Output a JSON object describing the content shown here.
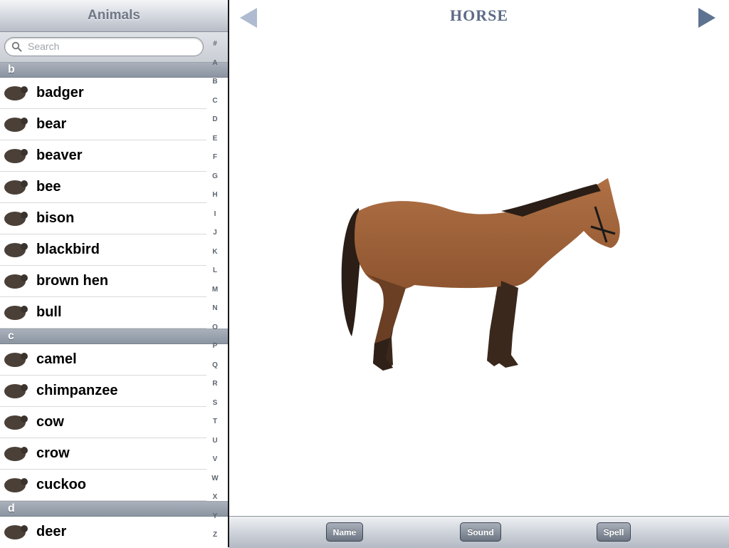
{
  "sidebar": {
    "title": "Animals",
    "search": {
      "placeholder": "Search",
      "value": ""
    },
    "index": [
      "#",
      "A",
      "B",
      "C",
      "D",
      "E",
      "F",
      "G",
      "H",
      "I",
      "J",
      "K",
      "L",
      "M",
      "N",
      "O",
      "P",
      "Q",
      "R",
      "S",
      "T",
      "U",
      "V",
      "W",
      "X",
      "Y",
      "Z"
    ],
    "sections": [
      {
        "letter": "b",
        "items": [
          {
            "label": "badger",
            "icon": "badger-icon"
          },
          {
            "label": "bear",
            "icon": "bear-icon"
          },
          {
            "label": "beaver",
            "icon": "beaver-icon"
          },
          {
            "label": "bee",
            "icon": "bee-icon"
          },
          {
            "label": "bison",
            "icon": "bison-icon"
          },
          {
            "label": "blackbird",
            "icon": "blackbird-icon"
          },
          {
            "label": "brown hen",
            "icon": "hen-icon"
          },
          {
            "label": "bull",
            "icon": "bull-icon"
          }
        ]
      },
      {
        "letter": "c",
        "items": [
          {
            "label": "camel",
            "icon": "camel-icon"
          },
          {
            "label": "chimpanzee",
            "icon": "chimpanzee-icon"
          },
          {
            "label": "cow",
            "icon": "cow-icon"
          },
          {
            "label": "crow",
            "icon": "crow-icon"
          },
          {
            "label": "cuckoo",
            "icon": "cuckoo-icon"
          }
        ]
      },
      {
        "letter": "d",
        "items": [
          {
            "label": "deer",
            "icon": "deer-icon"
          }
        ]
      }
    ]
  },
  "main": {
    "title": "HORSE",
    "prev_icon": "left-arrow-icon",
    "next_icon": "right-arrow-icon",
    "image_icon": "horse-image"
  },
  "toolbar": {
    "name_label": "Name",
    "sound_label": "Sound",
    "spell_label": "Spell"
  },
  "colors": {
    "title": "#5c6b86",
    "arrow_prev": "#aebbd0",
    "arrow_next": "#5e7391",
    "section_header": "#8b94a1",
    "button": "#6c7583"
  }
}
